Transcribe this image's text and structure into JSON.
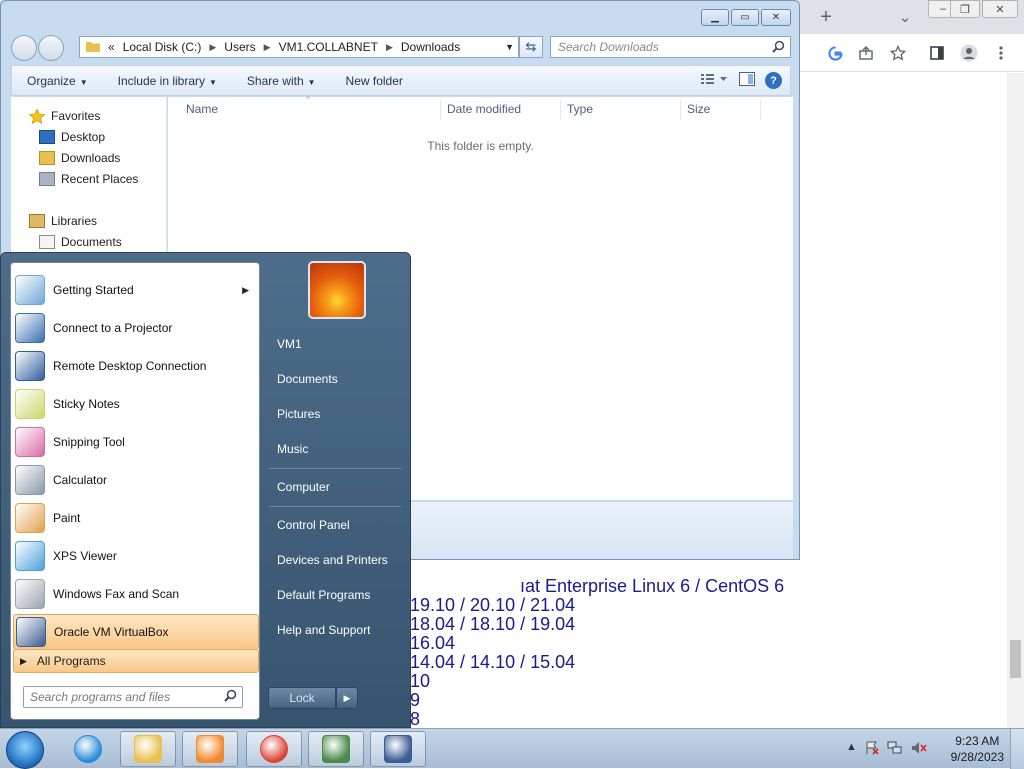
{
  "chrome": {
    "new_tab_symbol": "+",
    "tab_list_symbol": "⌄",
    "window_buttons": [
      "–",
      "❐",
      "✕"
    ],
    "content_lines": [
      "ıat Enterprise Linux 6 / CentOS 6",
      "19.10 / 20.10 / 21.04",
      "18.04 / 18.10 / 19.04",
      "16.04",
      "14.04 / 14.10 / 15.04",
      "10",
      "9",
      "8"
    ]
  },
  "explorer": {
    "address": {
      "prefix": "«",
      "segments": [
        "Local Disk (C:)",
        "Users",
        "VM1.COLLABNET",
        "Downloads"
      ]
    },
    "search_placeholder": "Search Downloads",
    "commands": [
      "Organize",
      "Include in library",
      "Share with",
      "New folder"
    ],
    "nav": {
      "favorites": "Favorites",
      "desktop": "Desktop",
      "downloads": "Downloads",
      "recent_places": "Recent Places",
      "libraries": "Libraries",
      "documents": "Documents"
    },
    "columns": [
      "Name",
      "Date modified",
      "Type",
      "Size"
    ],
    "empty_message": "This folder is empty.",
    "help_label": "?"
  },
  "start_menu": {
    "programs": [
      {
        "label": "Getting Started",
        "icon": "getting-started-icon",
        "color": "#6fa8d8",
        "arrow": "▶"
      },
      {
        "label": "Connect to a Projector",
        "icon": "projector-icon",
        "color": "#3b6fb0"
      },
      {
        "label": "Remote Desktop Connection",
        "icon": "remote-desktop-icon",
        "color": "#2f5e9e"
      },
      {
        "label": "Sticky Notes",
        "icon": "sticky-notes-icon",
        "color": "#c9d86a"
      },
      {
        "label": "Snipping Tool",
        "icon": "snipping-tool-icon",
        "color": "#d86aa8"
      },
      {
        "label": "Calculator",
        "icon": "calculator-icon",
        "color": "#8a98a8"
      },
      {
        "label": "Paint",
        "icon": "paint-icon",
        "color": "#e2a24a"
      },
      {
        "label": "XPS Viewer",
        "icon": "xps-viewer-icon",
        "color": "#4aa0d8"
      },
      {
        "label": "Windows Fax and Scan",
        "icon": "fax-scan-icon",
        "color": "#9aa4ae"
      },
      {
        "label": "Oracle VM VirtualBox",
        "icon": "virtualbox-icon",
        "color": "#3c5c94",
        "highlighted": true
      }
    ],
    "all_programs": "All Programs",
    "all_programs_arrow": "▶",
    "search_placeholder": "Search programs and files",
    "right_items": [
      "VM1",
      "Documents",
      "Pictures",
      "Music",
      "Computer",
      "Control Panel",
      "Devices and Printers",
      "Default Programs",
      "Help and Support"
    ],
    "lock_label": "Lock",
    "lock_arrow": "▶"
  },
  "taskbar": {
    "pinned": [
      {
        "name": "internet-explorer-icon",
        "color": "#2a8ad8"
      },
      {
        "name": "windows-explorer-icon",
        "color": "#e8c050"
      },
      {
        "name": "media-player-icon",
        "color": "#f08a30"
      },
      {
        "name": "chrome-icon",
        "color": "#db4437"
      },
      {
        "name": "vm-console-icon",
        "color": "#4a8a4a"
      },
      {
        "name": "virtualbox-taskbar-icon",
        "color": "#3c5c94"
      }
    ],
    "tray_arrow": "▲",
    "time": "9:23 AM",
    "date": "9/28/2023"
  }
}
